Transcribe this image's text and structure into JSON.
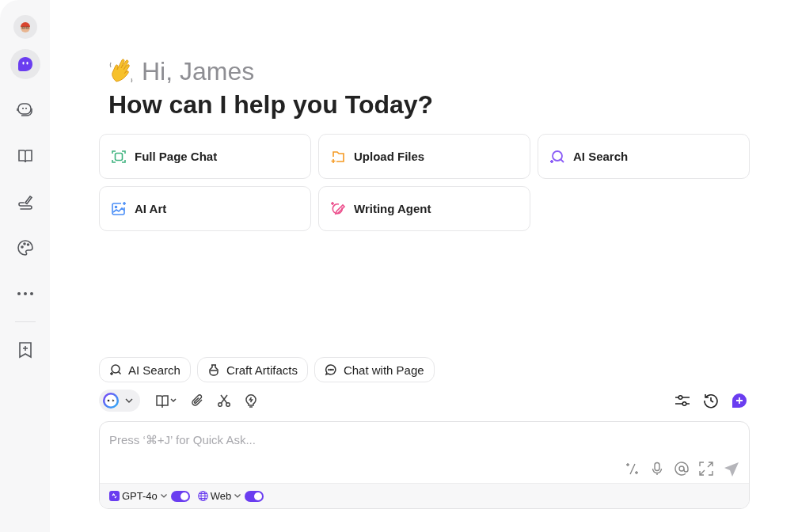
{
  "sidebar": {
    "items": [
      {
        "selected": true
      },
      {
        "selected": false
      },
      {
        "selected": false
      },
      {
        "selected": false
      },
      {
        "selected": false
      },
      {
        "selected": false
      },
      {
        "selected": false
      }
    ]
  },
  "greeting": "Hi, James",
  "headline": "How can I help you Today?",
  "actions": [
    {
      "label": "Full Page Chat"
    },
    {
      "label": "Upload Files"
    },
    {
      "label": "AI Search"
    },
    {
      "label": "AI Art"
    },
    {
      "label": "Writing Agent"
    }
  ],
  "chips": [
    {
      "label": "AI Search"
    },
    {
      "label": "Craft Artifacts"
    },
    {
      "label": "Chat with Page"
    }
  ],
  "composer": {
    "placeholder": "Press ‘⌘+J’ for Quick Ask...",
    "options": [
      {
        "label": "GPT-4o",
        "on": true
      },
      {
        "label": "Web",
        "on": true
      }
    ]
  }
}
